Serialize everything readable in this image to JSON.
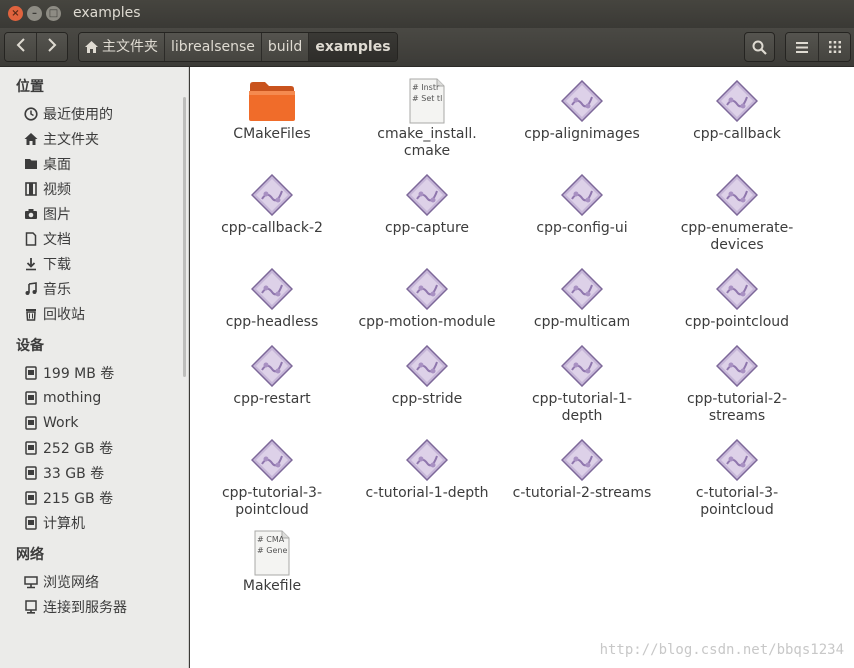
{
  "window": {
    "title": "examples"
  },
  "toolbar": {
    "breadcrumbs": [
      "主文件夹",
      "librealsense",
      "build",
      "examples"
    ]
  },
  "sidebar": {
    "sections": [
      {
        "title": "位置",
        "items": [
          {
            "label": "最近使用的",
            "icon": "clock-icon"
          },
          {
            "label": "主文件夹",
            "icon": "home-icon"
          },
          {
            "label": "桌面",
            "icon": "folder-icon"
          },
          {
            "label": "视频",
            "icon": "film-icon"
          },
          {
            "label": "图片",
            "icon": "camera-icon"
          },
          {
            "label": "文档",
            "icon": "document-icon"
          },
          {
            "label": "下载",
            "icon": "download-icon"
          },
          {
            "label": "音乐",
            "icon": "music-icon"
          },
          {
            "label": "回收站",
            "icon": "trash-icon"
          }
        ]
      },
      {
        "title": "设备",
        "items": [
          {
            "label": "199 MB 卷",
            "icon": "drive-icon"
          },
          {
            "label": "mothing",
            "icon": "drive-icon"
          },
          {
            "label": "Work",
            "icon": "drive-icon"
          },
          {
            "label": "252 GB 卷",
            "icon": "drive-icon"
          },
          {
            "label": "33 GB 卷",
            "icon": "drive-icon"
          },
          {
            "label": "215 GB 卷",
            "icon": "drive-icon"
          },
          {
            "label": "计算机",
            "icon": "drive-icon"
          }
        ]
      },
      {
        "title": "网络",
        "items": [
          {
            "label": "浏览网络",
            "icon": "network-icon"
          },
          {
            "label": "连接到服务器",
            "icon": "server-icon"
          }
        ]
      }
    ]
  },
  "files": [
    {
      "name": "CMakeFiles",
      "type": "folder"
    },
    {
      "name": "cmake_install.\ncmake",
      "type": "text",
      "preview": [
        "# Instr",
        "# Set tl"
      ]
    },
    {
      "name": "cpp-alignimages",
      "type": "exec"
    },
    {
      "name": "cpp-callback",
      "type": "exec"
    },
    {
      "name": "cpp-callback-2",
      "type": "exec"
    },
    {
      "name": "cpp-capture",
      "type": "exec"
    },
    {
      "name": "cpp-config-ui",
      "type": "exec"
    },
    {
      "name": "cpp-enumerate-\ndevices",
      "type": "exec"
    },
    {
      "name": "cpp-headless",
      "type": "exec"
    },
    {
      "name": "cpp-motion-module",
      "type": "exec"
    },
    {
      "name": "cpp-multicam",
      "type": "exec"
    },
    {
      "name": "cpp-pointcloud",
      "type": "exec"
    },
    {
      "name": "cpp-restart",
      "type": "exec"
    },
    {
      "name": "cpp-stride",
      "type": "exec"
    },
    {
      "name": "cpp-tutorial-1-\ndepth",
      "type": "exec"
    },
    {
      "name": "cpp-tutorial-2-\nstreams",
      "type": "exec"
    },
    {
      "name": "cpp-tutorial-3-\npointcloud",
      "type": "exec"
    },
    {
      "name": "c-tutorial-1-depth",
      "type": "exec"
    },
    {
      "name": "c-tutorial-2-streams",
      "type": "exec"
    },
    {
      "name": "c-tutorial-3-\npointcloud",
      "type": "exec"
    },
    {
      "name": "Makefile",
      "type": "text",
      "preview": [
        "# CMA",
        "# Gene"
      ]
    }
  ],
  "watermark": "http://blog.csdn.net/bbqs1234",
  "colors": {
    "titlebar": "#3c3b37",
    "close": "#e0633e",
    "folder": "#f06c2a",
    "exec": "#9a82b8"
  }
}
